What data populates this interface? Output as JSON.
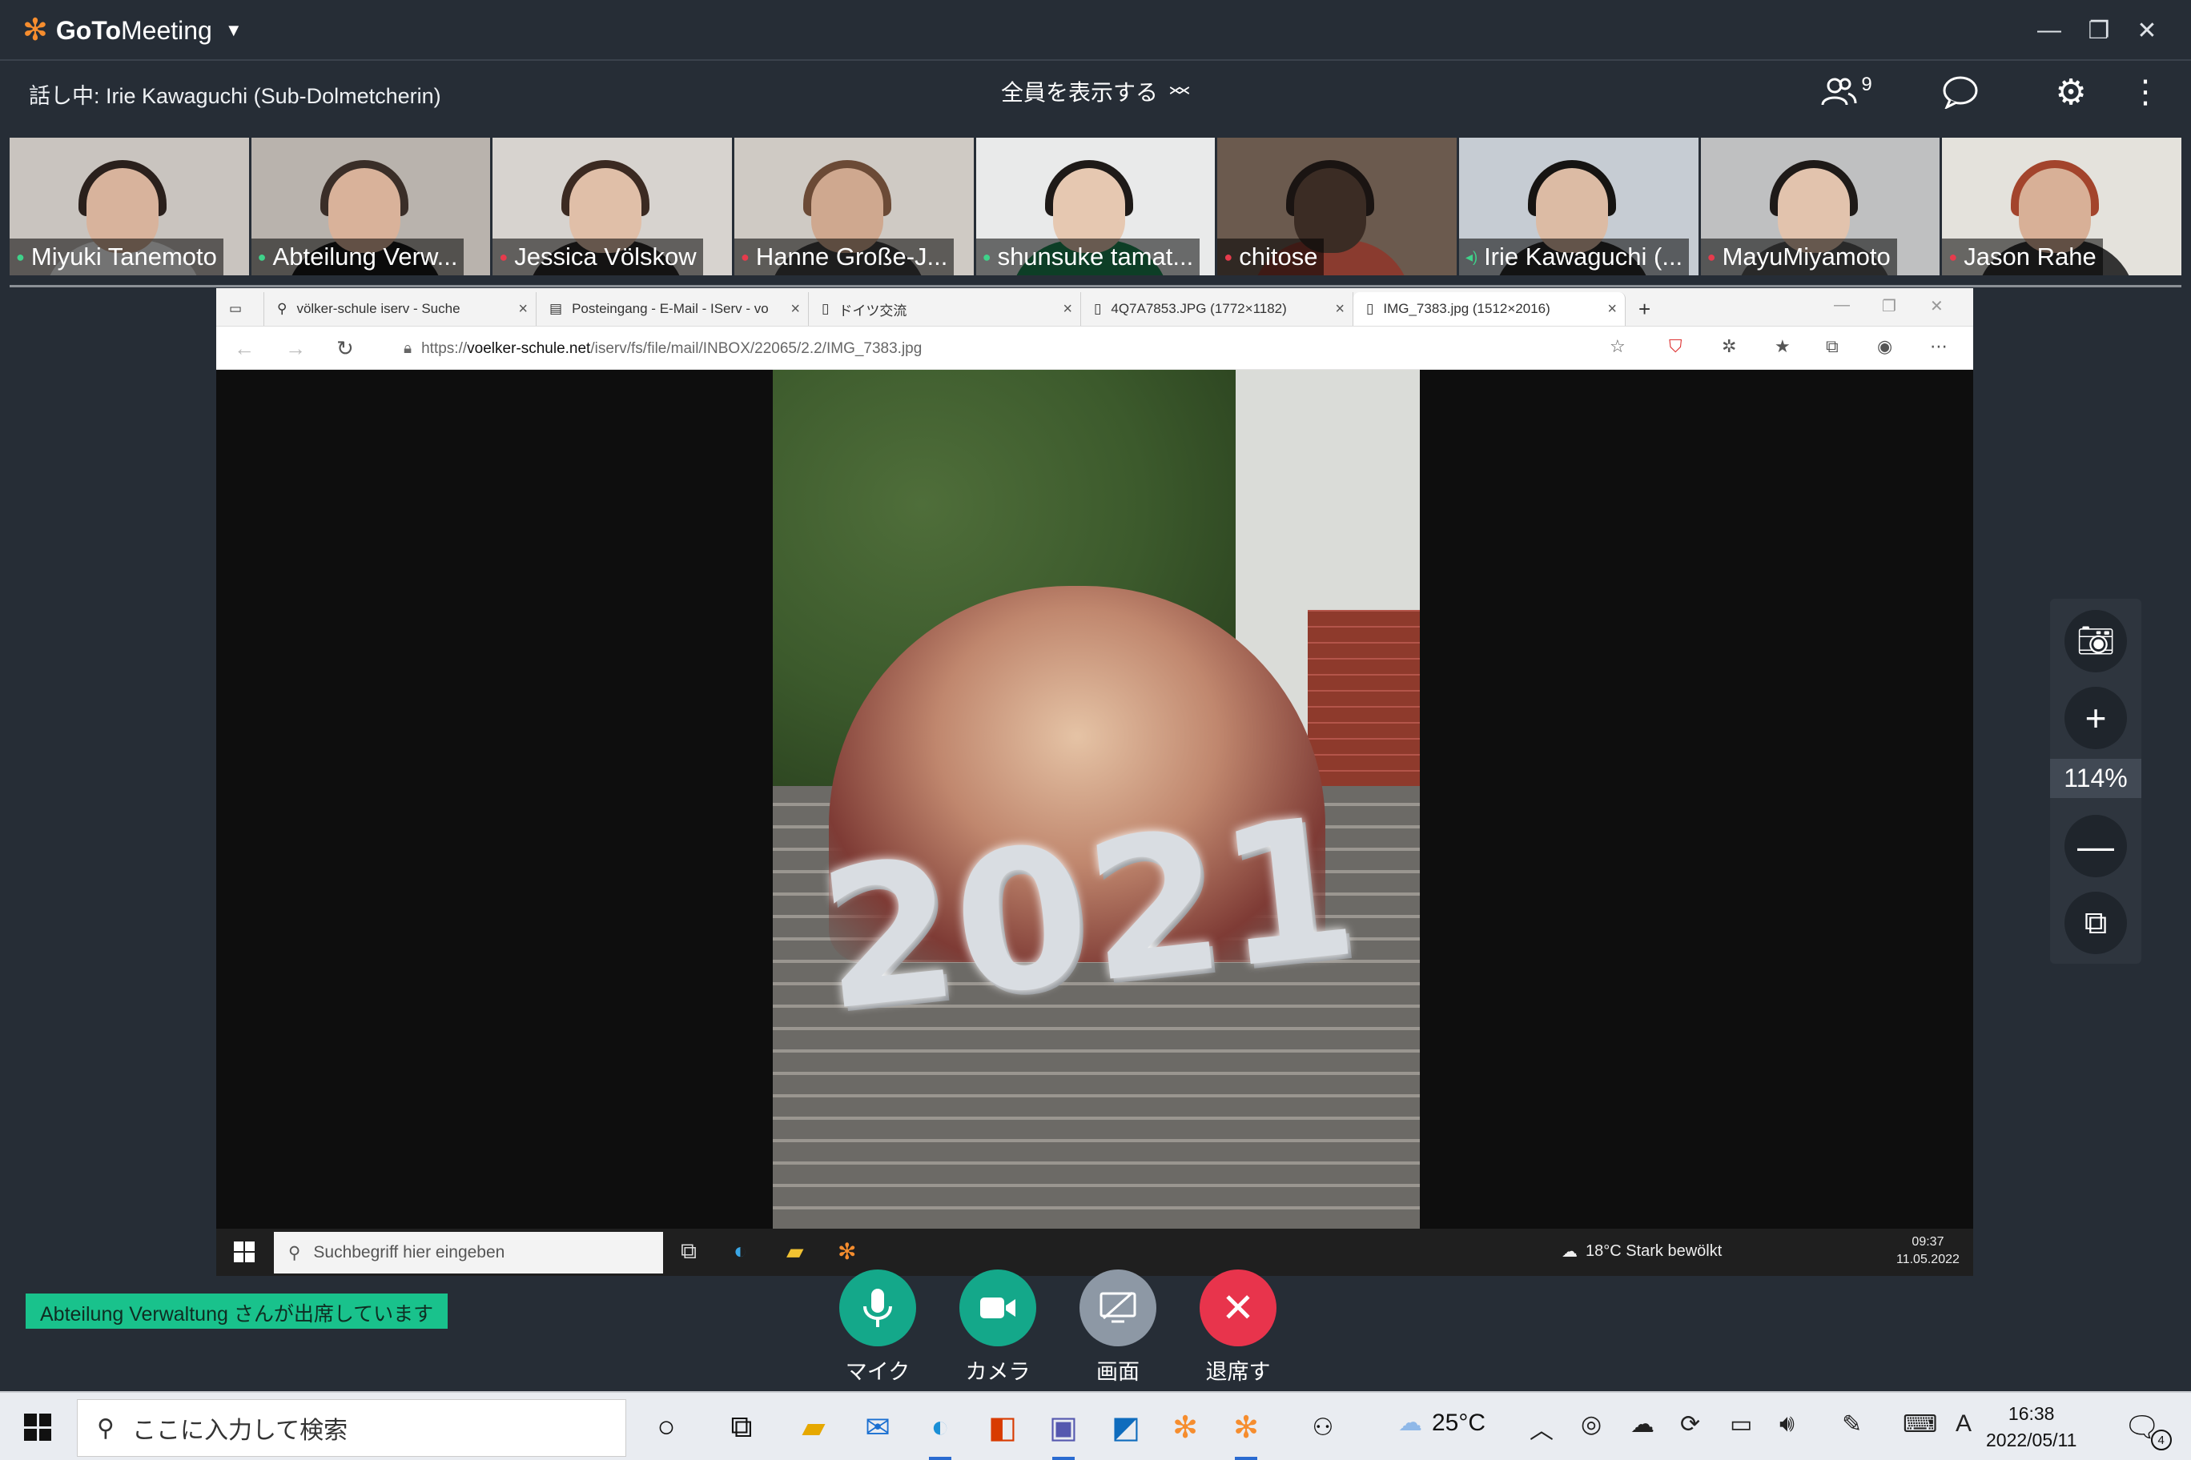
{
  "app": {
    "logo_text_bold": "GoTo",
    "logo_text_light": "Meeting",
    "window_controls": [
      "minimize",
      "restore",
      "close"
    ]
  },
  "info_bar": {
    "talking_label": "話し中: Irie Kawaguchi (Sub-Dolmetcherin)",
    "view_all_label": "全員を表示する",
    "attendee_count": "9"
  },
  "participants": [
    {
      "name": "Miyuki Tanemoto",
      "mic": "on"
    },
    {
      "name": "Abteilung Verw...",
      "mic": "on"
    },
    {
      "name": "Jessica Völskow",
      "mic": "off"
    },
    {
      "name": "Hanne Große-J...",
      "mic": "off"
    },
    {
      "name": "shunsuke tamat...",
      "mic": "on"
    },
    {
      "name": "chitose",
      "mic": "off"
    },
    {
      "name": "Irie Kawaguchi (...",
      "mic": "speaking"
    },
    {
      "name": "MayuMiyamoto",
      "mic": "off"
    },
    {
      "name": "Jason Rahe",
      "mic": "off"
    }
  ],
  "shared_screen": {
    "tabs": [
      {
        "label": "völker-schule iserv - Suche",
        "icon": "search-icon"
      },
      {
        "label": "Posteingang - E-Mail - IServ - vo",
        "icon": "mail-icon"
      },
      {
        "label": "ドイツ交流",
        "icon": "page-icon"
      },
      {
        "label": "4Q7A7853.JPG (1772×1182)",
        "icon": "page-icon"
      },
      {
        "label": "IMG_7383.jpg (1512×2016)",
        "icon": "page-icon",
        "active": true
      }
    ],
    "new_tab_symbol": "+",
    "url_prefix": "https://",
    "url_host": "voelker-schule.net",
    "url_path": "/iserv/fs/file/mail/INBOX/22065/2.2/IMG_7383.jpg",
    "photo_balloon_text": "2021",
    "inner_taskbar": {
      "search_placeholder": "Suchbegriff hier eingeben",
      "weather": "18°C  Stark bewölkt",
      "time": "09:37",
      "date": "11.05.2022"
    }
  },
  "zoom_panel": {
    "zoom_level": "114%"
  },
  "notification": {
    "text": "Abteilung  Verwaltung さんが出席しています"
  },
  "controls": [
    {
      "label": "マイク",
      "color": "#14a88a",
      "icon": "microphone-icon"
    },
    {
      "label": "カメラ",
      "color": "#14a88a",
      "icon": "camera-icon"
    },
    {
      "label": "画面",
      "color": "#8d98a5",
      "icon": "screen-share-icon"
    },
    {
      "label": "退席する",
      "color": "#e8344c",
      "icon": "close-icon"
    }
  ],
  "win_taskbar": {
    "search_placeholder": "ここに入力して検索",
    "temperature": "25°C",
    "time": "16:38",
    "date": "2022/05/11",
    "ime": "A",
    "notification_count": "4"
  }
}
